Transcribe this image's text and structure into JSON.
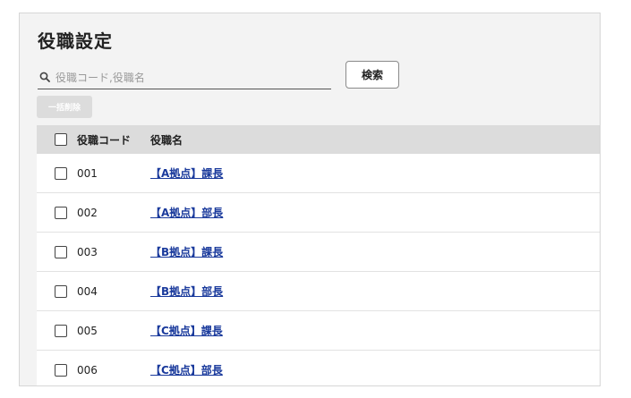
{
  "page": {
    "title": "役職設定"
  },
  "search": {
    "placeholder": "役職コード,役職名",
    "value": "",
    "button_label": "検索"
  },
  "toolbar": {
    "bulk_delete_label": "一括削除"
  },
  "table": {
    "headers": {
      "code": "役職コード",
      "name": "役職名"
    },
    "rows": [
      {
        "code": "001",
        "name": "【A拠点】課長"
      },
      {
        "code": "002",
        "name": "【A拠点】部長"
      },
      {
        "code": "003",
        "name": "【B拠点】課長"
      },
      {
        "code": "004",
        "name": "【B拠点】部長"
      },
      {
        "code": "005",
        "name": "【C拠点】課長"
      },
      {
        "code": "006",
        "name": "【C拠点】部長"
      }
    ]
  },
  "colors": {
    "panel_bg": "#f3f3f3",
    "header_bg": "#dcdcdc",
    "link": "#1a3a9c",
    "disabled_button_bg": "#dcdcdc"
  },
  "icons": {
    "search": "search-icon",
    "checkbox": "checkbox-icon"
  }
}
